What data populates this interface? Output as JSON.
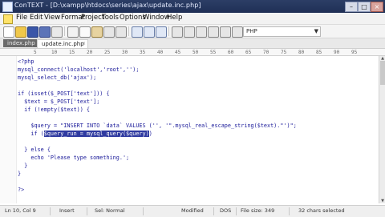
{
  "window": {
    "title": "ConTEXT - [D:\\xampp\\htdocs\\series\\ajax\\update.inc.php]",
    "min_label": "–",
    "max_label": "□",
    "close_label": "×"
  },
  "menu": [
    "File",
    "Edit",
    "View",
    "Format",
    "Project",
    "Tools",
    "Options",
    "Window",
    "Help"
  ],
  "toolbar": {
    "highlighter": "PHP"
  },
  "tabs": [
    {
      "label": "index.php",
      "active": false
    },
    {
      "label": "update.inc.php",
      "active": true
    }
  ],
  "ruler": [
    "5",
    "10",
    "15",
    "20",
    "25",
    "30",
    "35",
    "40",
    "45",
    "50",
    "55",
    "60",
    "65",
    "70",
    "75",
    "80",
    "85",
    "90",
    "95"
  ],
  "code": [
    {
      "text": "<?php"
    },
    {
      "text": "mysql_connect('localhost','root','');"
    },
    {
      "text": "mysql_select_db('ajax');"
    },
    {
      "text": ""
    },
    {
      "text": "if (isset($_POST['text'])) {"
    },
    {
      "text": "  $text = $_POST['text'];"
    },
    {
      "text": "  if (!empty($text)) {"
    },
    {
      "text": ""
    },
    {
      "text": "    $query = \"INSERT INTO `data` VALUES ('', '\".mysql_real_escape_string($text).\"')\";"
    },
    {
      "text_before": "    if (",
      "highlight": "$query_run = mysql_query($query)",
      "text_after": ")"
    },
    {
      "text": ""
    },
    {
      "text": "  } else {"
    },
    {
      "text": "    echo 'Please type something.';"
    },
    {
      "text": "  }"
    },
    {
      "text": "}"
    },
    {
      "text": ""
    },
    {
      "text": "?>"
    }
  ],
  "status": {
    "position": "Ln 10, Col 9",
    "mode": "Insert",
    "sel": "Sel: Normal",
    "modified": "Modified",
    "format": "DOS",
    "filesize": "File size: 349",
    "selected": "32 chars selected"
  }
}
